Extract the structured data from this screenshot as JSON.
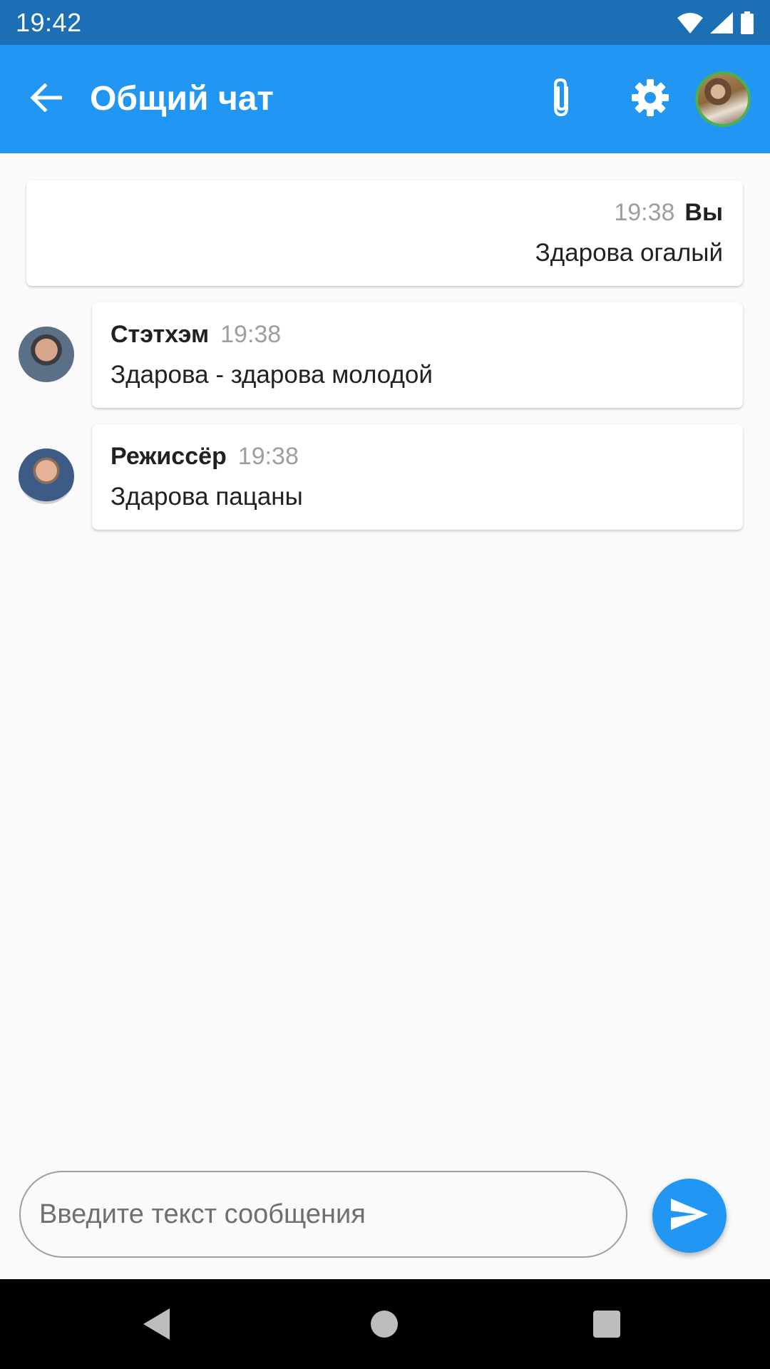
{
  "status_bar": {
    "time": "19:42",
    "icons": [
      "wifi-icon",
      "cell-signal-icon",
      "battery-icon"
    ]
  },
  "app_bar": {
    "title": "Общий чат",
    "back_icon": "arrow-left-icon",
    "attach_icon": "paperclip-icon",
    "settings_icon": "gear-icon",
    "profile_avatar": "user-avatar"
  },
  "messages": [
    {
      "author": "Вы",
      "time": "19:38",
      "text": "Здарова огалый",
      "own": true
    },
    {
      "author": "Стэтхэм",
      "time": "19:38",
      "text": "Здарова - здарова молодой",
      "own": false
    },
    {
      "author": "Режиссёр",
      "time": "19:38",
      "text": "Здарова пацаны",
      "own": false
    }
  ],
  "composer": {
    "placeholder": "Введите текст сообщения",
    "value": "",
    "send_icon": "send-icon"
  },
  "nav_bar": {
    "icons": [
      "nav-back-icon",
      "nav-home-icon",
      "nav-recents-icon"
    ]
  },
  "colors": {
    "status_bar": "#1c6fb5",
    "app_bar": "#2196f3",
    "background": "#fafafa",
    "send_button": "#2196f3",
    "avatar_ring": "#4caf50"
  }
}
